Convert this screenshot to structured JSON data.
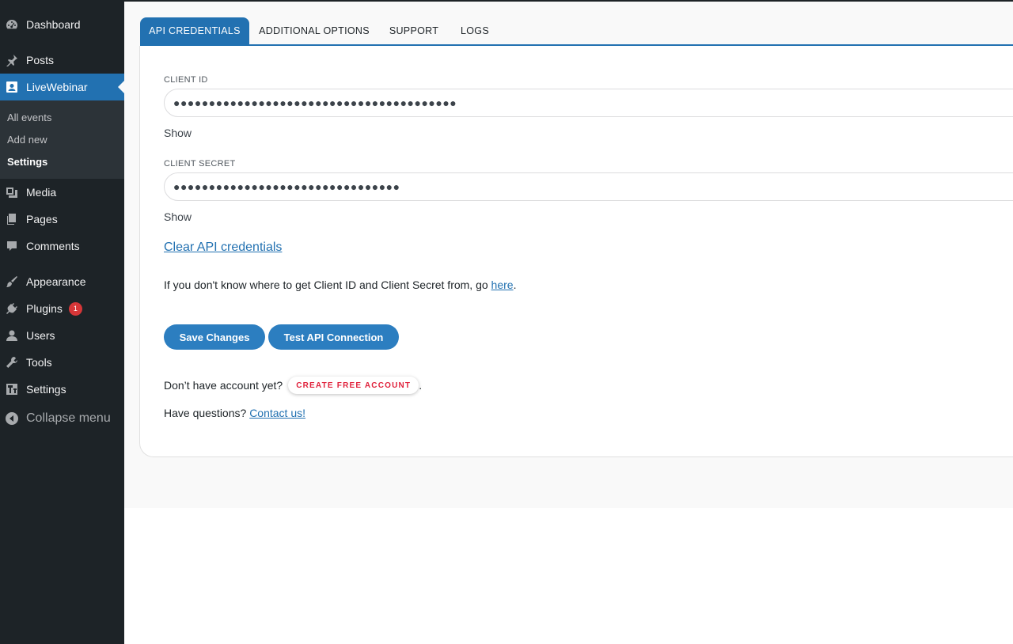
{
  "sidebar": {
    "dashboard": "Dashboard",
    "posts": "Posts",
    "livewebinar": "LiveWebinar",
    "submenu": {
      "all_events": "All events",
      "add_new": "Add new",
      "settings": "Settings"
    },
    "media": "Media",
    "pages": "Pages",
    "comments": "Comments",
    "appearance": "Appearance",
    "plugins": "Plugins",
    "plugins_badge": "1",
    "users": "Users",
    "tools": "Tools",
    "settings": "Settings",
    "collapse": "Collapse menu"
  },
  "tabs": {
    "api_credentials": "API CREDENTIALS",
    "additional_options": "ADDITIONAL OPTIONS",
    "support": "SUPPORT",
    "logs": "LOGS"
  },
  "form": {
    "client_id_label": "CLIENT ID",
    "client_id_value": "●●●●●●●●●●●●●●●●●●●●●●●●●●●●●●●●●●●●●●●●",
    "client_id_show": "Show",
    "client_secret_label": "CLIENT SECRET",
    "client_secret_value": "●●●●●●●●●●●●●●●●●●●●●●●●●●●●●●●●",
    "client_secret_show": "Show",
    "clear_link": "Clear API credentials",
    "help_prefix": "If you don't know where to get Client ID and Client Secret from, go ",
    "help_link": "here",
    "help_suffix": ".",
    "save_button": "Save Changes",
    "test_button": "Test API Connection",
    "account_prefix": "Don’t have account yet?",
    "free_account_button": "CREATE FREE ACCOUNT",
    "account_suffix": ".",
    "questions_prefix": "Have questions? ",
    "contact_link": "Contact us!"
  },
  "colors": {
    "sidebar_bg": "#1d2327",
    "accent": "#2271b1",
    "badge": "#d63638",
    "free_account_text": "#e0213b"
  }
}
